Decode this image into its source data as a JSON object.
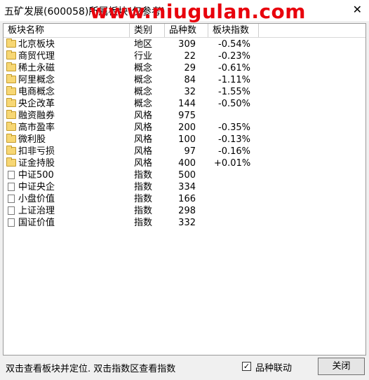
{
  "window": {
    "title": "五矿发展(600058)所属板块(仅参考)",
    "watermark": "www.niugulan.com",
    "close_glyph": "✕"
  },
  "table": {
    "headers": [
      "板块名称",
      "类别",
      "品种数",
      "板块指数"
    ],
    "rows": [
      {
        "icon": "folder",
        "name": "北京板块",
        "type": "地区",
        "count": "309",
        "index": "-0.54%"
      },
      {
        "icon": "folder",
        "name": "商贸代理",
        "type": "行业",
        "count": "22",
        "index": "-0.23%"
      },
      {
        "icon": "folder",
        "name": "稀土永磁",
        "type": "概念",
        "count": "29",
        "index": "-0.61%"
      },
      {
        "icon": "folder",
        "name": "阿里概念",
        "type": "概念",
        "count": "84",
        "index": "-1.11%"
      },
      {
        "icon": "folder",
        "name": "电商概念",
        "type": "概念",
        "count": "32",
        "index": "-1.55%"
      },
      {
        "icon": "folder",
        "name": "央企改革",
        "type": "概念",
        "count": "144",
        "index": "-0.50%"
      },
      {
        "icon": "folder",
        "name": "融资融券",
        "type": "风格",
        "count": "975",
        "index": ""
      },
      {
        "icon": "folder",
        "name": "高市盈率",
        "type": "风格",
        "count": "200",
        "index": "-0.35%"
      },
      {
        "icon": "folder",
        "name": "微利股",
        "type": "风格",
        "count": "100",
        "index": "-0.13%"
      },
      {
        "icon": "folder",
        "name": "扣非亏损",
        "type": "风格",
        "count": "97",
        "index": "-0.16%"
      },
      {
        "icon": "folder",
        "name": "证金持股",
        "type": "风格",
        "count": "400",
        "index": "+0.01%"
      },
      {
        "icon": "doc",
        "name": "中证500",
        "type": "指数",
        "count": "500",
        "index": ""
      },
      {
        "icon": "doc",
        "name": "中证央企",
        "type": "指数",
        "count": "334",
        "index": ""
      },
      {
        "icon": "doc",
        "name": "小盘价值",
        "type": "指数",
        "count": "166",
        "index": ""
      },
      {
        "icon": "doc",
        "name": "上证治理",
        "type": "指数",
        "count": "298",
        "index": ""
      },
      {
        "icon": "doc",
        "name": "国证价值",
        "type": "指数",
        "count": "332",
        "index": ""
      }
    ]
  },
  "footer": {
    "hint": "双击查看板块并定位. 双击指数区查看指数",
    "checkbox_label": "品种联动",
    "checkbox_checked": true,
    "check_glyph": "✓",
    "close_label": "关闭"
  }
}
